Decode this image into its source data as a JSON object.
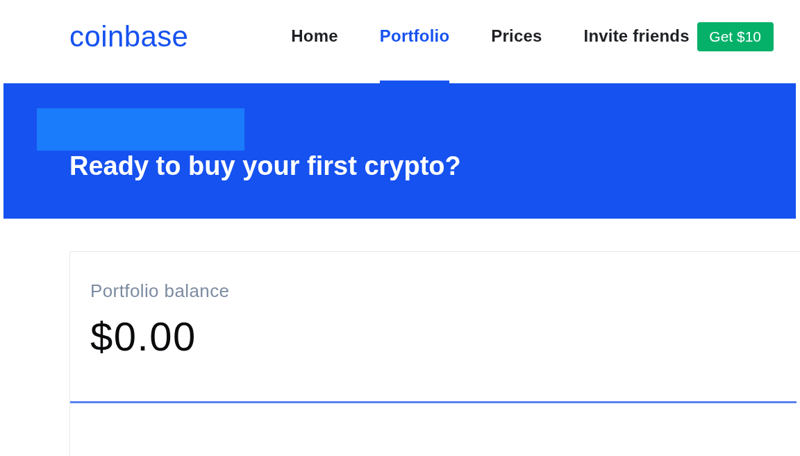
{
  "header": {
    "logo": "coinbase",
    "tabs": [
      {
        "label": "Home",
        "selected": false
      },
      {
        "label": "Portfolio",
        "selected": true
      },
      {
        "label": "Prices",
        "selected": false
      }
    ],
    "invite": {
      "label": "Invite friends",
      "button": "Get $10"
    }
  },
  "banner": {
    "heading": "Ready to buy your first crypto?"
  },
  "balance_card": {
    "label": "Portfolio balance",
    "value": "$0.00"
  }
}
